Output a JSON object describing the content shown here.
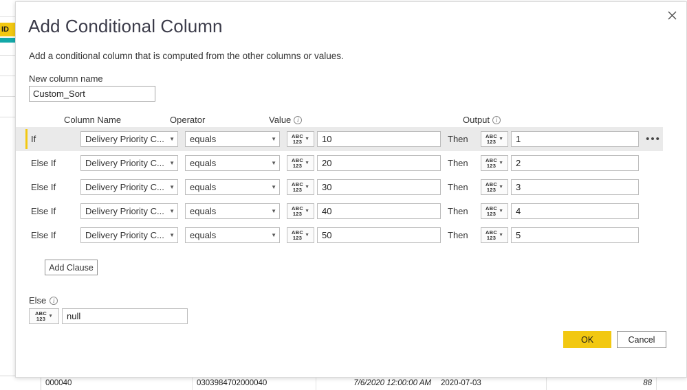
{
  "background": {
    "id_badge_label": "ID",
    "grid_row": {
      "cells": [
        "000040",
        "0303984702000040",
        "",
        "7/6/2020 12:00:00 AM",
        "2020-07-03",
        "88"
      ]
    }
  },
  "dialog": {
    "title": "Add Conditional Column",
    "subtitle": "Add a conditional column that is computed from the other columns or values.",
    "close_icon": "close-icon",
    "new_column_name": {
      "label": "New column name",
      "value": "Custom_Sort"
    },
    "headers": {
      "column_name": "Column Name",
      "operator": "Operator",
      "value": "Value",
      "output": "Output",
      "info_icon": "info-icon"
    },
    "keywords": {
      "if": "If",
      "else_if": "Else If",
      "then": "Then"
    },
    "type_icon": {
      "top": "ABC",
      "bottom": "123",
      "caret": "▾"
    },
    "clauses": [
      {
        "keyword": "If",
        "column": "Delivery Priority C...",
        "operator": "equals",
        "value_type": "ABC123",
        "value": "10",
        "then": "Then",
        "output_type": "ABC123",
        "output": "1",
        "active": true,
        "menu": "•••"
      },
      {
        "keyword": "Else If",
        "column": "Delivery Priority C...",
        "operator": "equals",
        "value_type": "ABC123",
        "value": "20",
        "then": "Then",
        "output_type": "ABC123",
        "output": "2",
        "active": false,
        "menu": ""
      },
      {
        "keyword": "Else If",
        "column": "Delivery Priority C...",
        "operator": "equals",
        "value_type": "ABC123",
        "value": "30",
        "then": "Then",
        "output_type": "ABC123",
        "output": "3",
        "active": false,
        "menu": ""
      },
      {
        "keyword": "Else If",
        "column": "Delivery Priority C...",
        "operator": "equals",
        "value_type": "ABC123",
        "value": "40",
        "then": "Then",
        "output_type": "ABC123",
        "output": "4",
        "active": false,
        "menu": ""
      },
      {
        "keyword": "Else If",
        "column": "Delivery Priority C...",
        "operator": "equals",
        "value_type": "ABC123",
        "value": "50",
        "then": "Then",
        "output_type": "ABC123",
        "output": "5",
        "active": false,
        "menu": ""
      }
    ],
    "add_clause_label": "Add Clause",
    "else_section": {
      "label": "Else",
      "value": "null"
    },
    "footer": {
      "ok_label": "OK",
      "cancel_label": "Cancel"
    }
  },
  "colors": {
    "accent_yellow": "#f2c811",
    "teal": "#13a8a8",
    "row_highlight": "#eaeaea",
    "title_text": "#3b3b49"
  }
}
